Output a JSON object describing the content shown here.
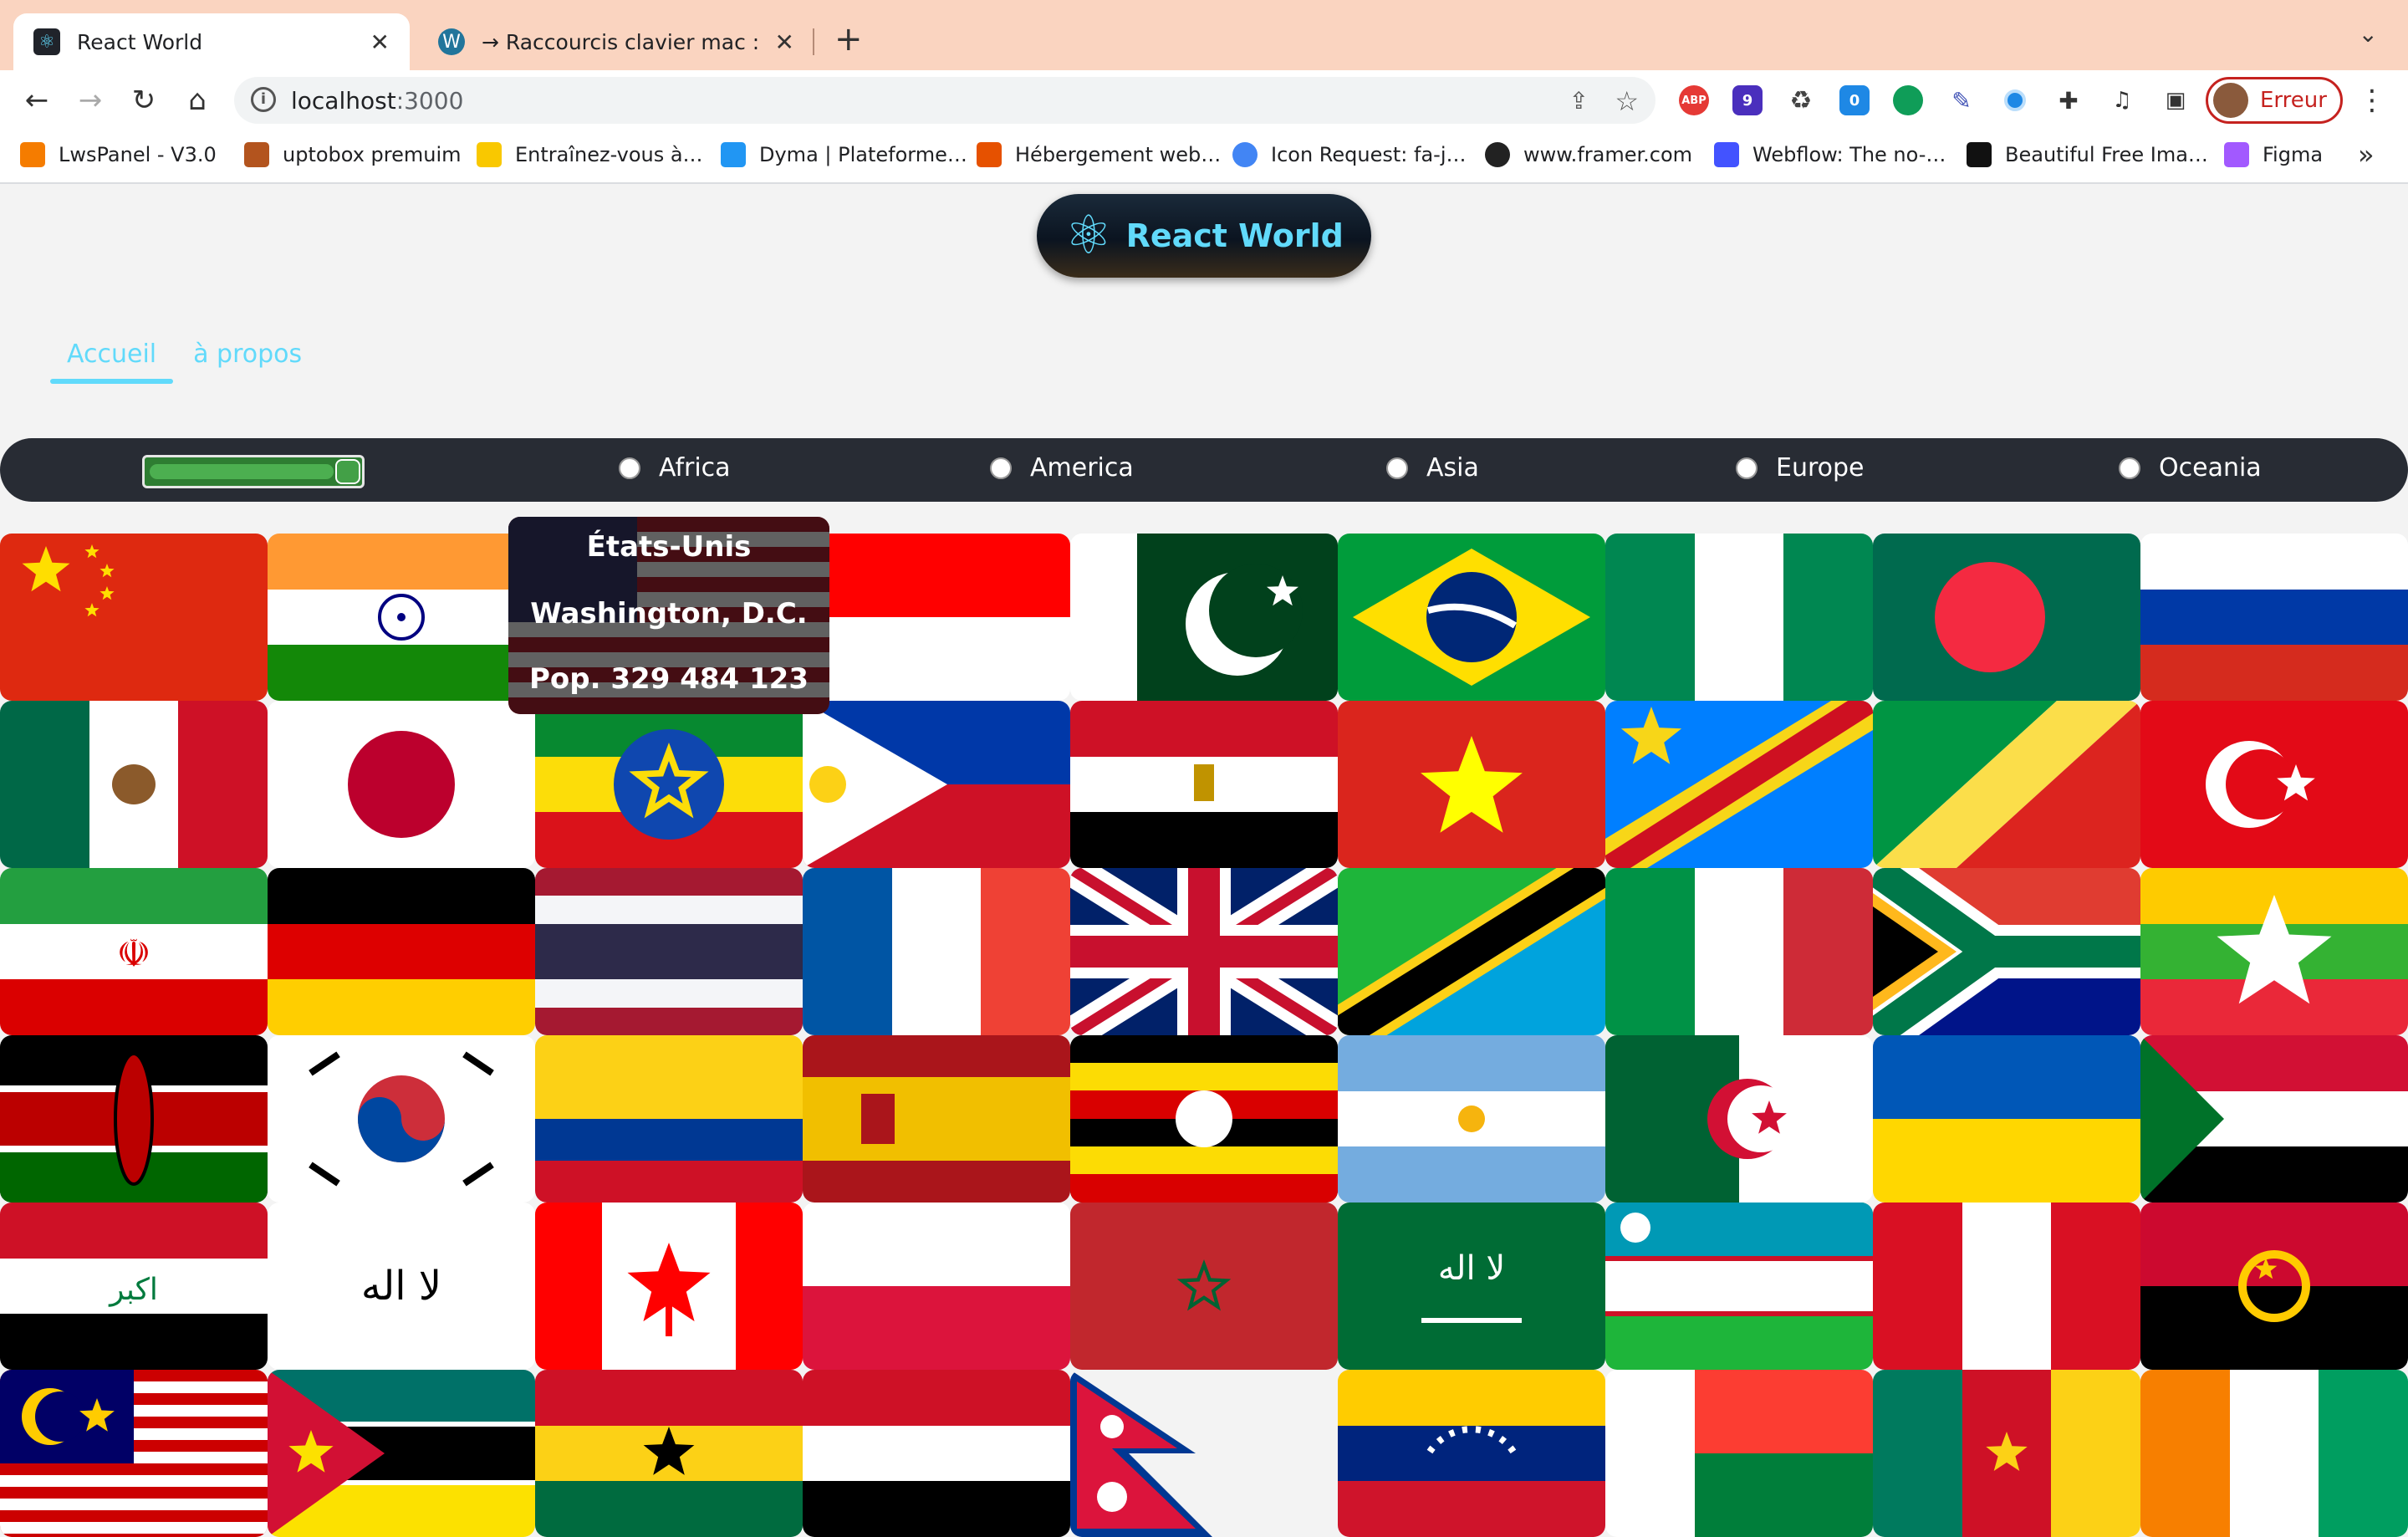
{
  "browser": {
    "tabs": [
      {
        "title": "React World",
        "favicon": "react-icon"
      },
      {
        "title": "→ Raccourcis clavier mac : acc",
        "favicon": "wordpress-icon"
      }
    ],
    "url_host": "localhost",
    "url_port": ":3000",
    "profile_label": "Erreur",
    "extensions": [
      "adblock-icon",
      "graduation-cap-icon",
      "recycle-icon",
      "counter-icon",
      "chat-icon",
      "eyedropper-icon",
      "record-icon",
      "puzzle-icon",
      "media-icon",
      "sidepanel-icon"
    ],
    "ext_badges": {
      "graduation": "9",
      "counter": "0"
    },
    "bookmarks": [
      "LwsPanel - V3.0",
      "uptobox premuim",
      "Entraînez-vous à…",
      "Dyma | Plateforme…",
      "Hébergement web…",
      "Icon Request: fa-j…",
      "www.framer.com",
      "Webflow: The no-…",
      "Beautiful Free Ima…",
      "Figma"
    ]
  },
  "app": {
    "logo_text": "React World",
    "nav": [
      {
        "label": "Accueil",
        "active": true
      },
      {
        "label": "à propos",
        "active": false
      }
    ],
    "filter": {
      "range_level": 1.0,
      "regions": [
        "Africa",
        "America",
        "Asia",
        "Europe",
        "Oceania"
      ],
      "selected": null
    },
    "hovered_country": {
      "name": "États-Unis",
      "capital": "Washington, D.C.",
      "population": "Pop. 329 484 123"
    },
    "flags": [
      "china",
      "india",
      "usa",
      "indonesia",
      "pakistan",
      "brazil",
      "nigeria",
      "bangladesh",
      "russia",
      "mexico",
      "japan",
      "ethiopia",
      "philippines",
      "egypt",
      "vietnam",
      "dr-congo",
      "congo",
      "turkey",
      "iran",
      "germany",
      "thailand",
      "france",
      "united-kingdom",
      "tanzania",
      "italy",
      "south-africa",
      "myanmar",
      "kenya",
      "south-korea",
      "colombia",
      "spain",
      "uganda",
      "argentina",
      "algeria",
      "ukraine",
      "sudan",
      "iraq",
      "afghanistan",
      "canada",
      "poland",
      "morocco",
      "saudi-arabia",
      "uzbekistan",
      "peru",
      "angola",
      "malaysia",
      "mozambique",
      "ghana",
      "yemen",
      "nepal",
      "venezuela",
      "madagascar",
      "cameroon",
      "ivory-coast"
    ]
  },
  "colors": {
    "accent": "#61dafb",
    "filterbar": "#282c34",
    "tabstrip": "#fad4c0",
    "profile": "#c5221f"
  }
}
